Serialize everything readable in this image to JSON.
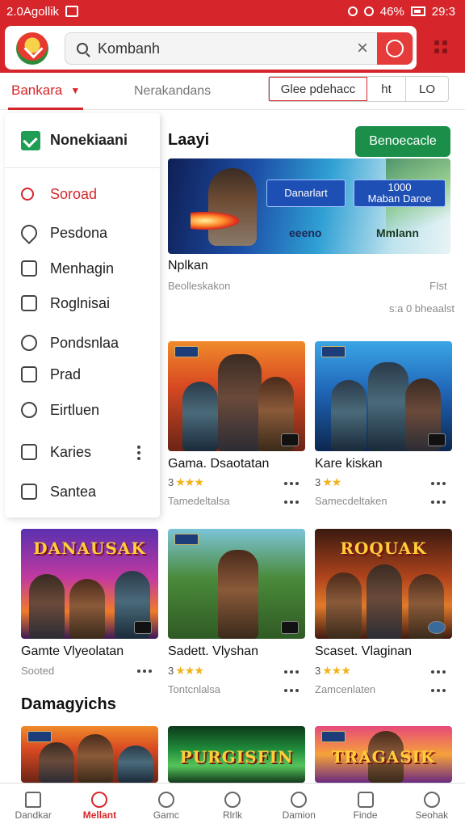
{
  "status_bar": {
    "left_text": "2.0Agollik",
    "right_text": "46%",
    "time": "29:3"
  },
  "search": {
    "value": "Kombanh"
  },
  "filter": {
    "tab_active": "Bankara",
    "tab_other": "Nerakandans",
    "seg1": "Glee pdehacc",
    "seg2": "ht",
    "seg3": "LO"
  },
  "drawer": {
    "title": "Nonekiaani",
    "items": [
      {
        "label": "Soroad",
        "icon": "search-icon"
      },
      {
        "label": "Pesdona",
        "icon": "pin-icon"
      },
      {
        "label": "Menhagin",
        "icon": "page-icon"
      },
      {
        "label": "Roglnisai",
        "icon": "document-icon"
      },
      {
        "label": "Pondsnlaa",
        "icon": "camera-icon"
      },
      {
        "label": "Prad",
        "icon": "card-icon"
      },
      {
        "label": "Eirtluen",
        "icon": "chat-icon"
      },
      {
        "label": "Karies",
        "icon": "store-icon"
      },
      {
        "label": "Santea",
        "icon": "grid-icon"
      }
    ]
  },
  "featured": {
    "section_title": "Laayi",
    "button_label": "Benoecacle",
    "banner": {
      "chip1": "Danarlart",
      "chip2_line1": "1000",
      "chip2_line2": "Maban Daroe",
      "label1": "eeeno",
      "label2": "Mmlann"
    },
    "title": "Nplkan",
    "meta_left": "Beolleskakon",
    "meta_right": "FIst",
    "meta_right2": "s:a 0 bheaalst"
  },
  "grid_row1": [
    {
      "title": "Gama. Dsaotatan",
      "rating_num": "3",
      "stars": "★★★",
      "sub": "Tamedeltalsa",
      "theme": "t-red"
    },
    {
      "title": "Kare kiskan",
      "rating_num": "3",
      "stars": "★★",
      "sub": "Samecdeltaken",
      "theme": "t-blue"
    }
  ],
  "grid_row2": [
    {
      "title": "Gamte Vlyeolatan",
      "rating_num": "",
      "stars": "",
      "sub": "Sooted",
      "theme": "t-purple",
      "logo": "DANAUSAK"
    },
    {
      "title": "Sadett. Vlyshan",
      "rating_num": "3",
      "stars": "★★★",
      "sub": "Tontcnlalsa",
      "theme": "t-jungle",
      "logo": ""
    },
    {
      "title": "Scaset. Vlaginan",
      "rating_num": "3",
      "stars": "★★★",
      "sub": "Zamcenlaten",
      "theme": "t-fire",
      "logo": "ROQUAK"
    }
  ],
  "section2_title": "Damagyichs",
  "grid_row3": [
    {
      "theme": "t-red",
      "logo": ""
    },
    {
      "theme": "t-green",
      "logo": "PURGISFIN"
    },
    {
      "theme": "t-sunset",
      "logo": "TRAGASIK"
    }
  ],
  "bottom_nav": [
    {
      "label": "Dandkar",
      "icon": "home-icon"
    },
    {
      "label": "Mellant",
      "icon": "search-icon",
      "active": true
    },
    {
      "label": "Gamc",
      "icon": "search-icon"
    },
    {
      "label": "Rlrlk",
      "icon": "leaf-icon"
    },
    {
      "label": "Damion",
      "icon": "search-icon"
    },
    {
      "label": "Finde",
      "icon": "note-icon"
    },
    {
      "label": "Seohak",
      "icon": "user-icon"
    }
  ],
  "colors": {
    "brand": "#d7262b",
    "green": "#1b8f4a",
    "star": "#f2b21a"
  }
}
